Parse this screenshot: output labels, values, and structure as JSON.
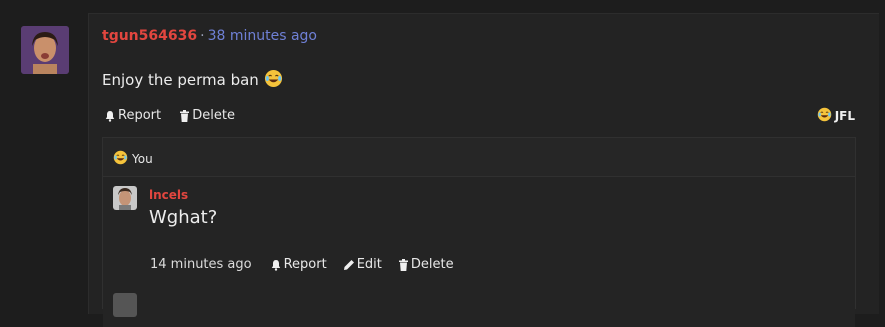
{
  "post": {
    "username": "tgun564636",
    "separator": "·",
    "time": "38 minutes ago",
    "body": "Enjoy the perma ban",
    "actions": {
      "report": "Report",
      "delete": "Delete"
    },
    "reaction_label": "JFL",
    "emoji_icon": "laughing-crying-emoji"
  },
  "reply_section": {
    "reaction_label": "You",
    "reply": {
      "username": "lncels",
      "text": "Wghat?",
      "time": "14 minutes ago",
      "actions": {
        "report": "Report",
        "edit": "Edit",
        "delete": "Delete"
      }
    }
  },
  "colors": {
    "username": "#e2463f",
    "time_link": "#6f80d6",
    "background": "#1d1d1d",
    "card": "#232323"
  }
}
